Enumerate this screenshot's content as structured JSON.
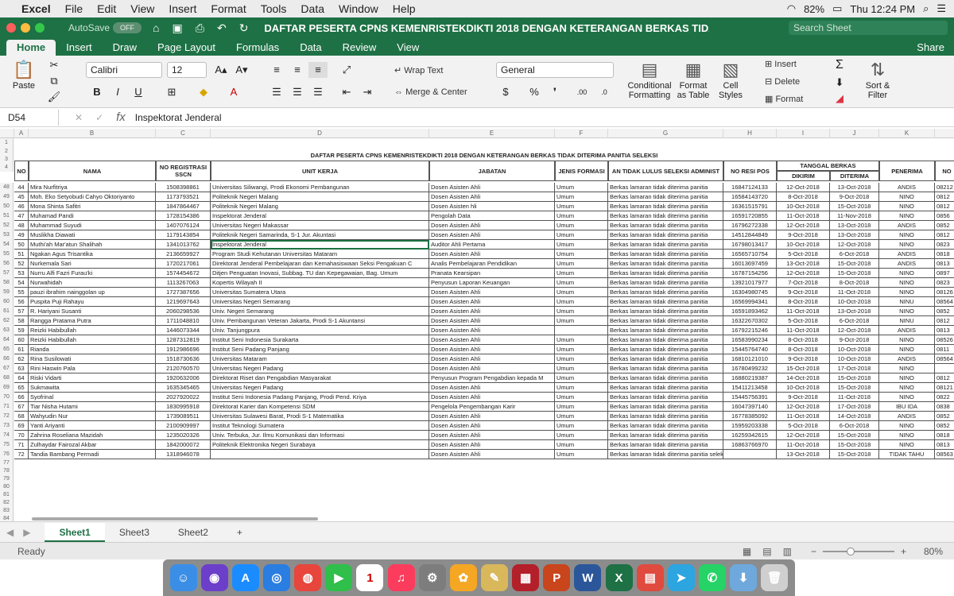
{
  "menubar": {
    "apple": "",
    "app": "Excel",
    "items": [
      "File",
      "Edit",
      "View",
      "Insert",
      "Format",
      "Tools",
      "Data",
      "Window",
      "Help"
    ],
    "battery": "82%",
    "clock": "Thu 12:24 PM"
  },
  "titlebar": {
    "autosave": "AutoSave",
    "toggle": "OFF",
    "doc_title": "DAFTAR PESERTA CPNS KEMENRISTEKDIKTI 2018 DENGAN KETERANGAN BERKAS TIDAK DIT...",
    "search_placeholder": "Search Sheet"
  },
  "ribbon_tabs": [
    "Home",
    "Insert",
    "Draw",
    "Page Layout",
    "Formulas",
    "Data",
    "Review",
    "View"
  ],
  "share": "Share",
  "ribbon": {
    "paste": "Paste",
    "font": "Calibri",
    "size": "12",
    "wrap": "Wrap Text",
    "merge": "Merge & Center",
    "numfmt": "General",
    "cond": [
      "Conditional",
      "Formatting"
    ],
    "fmt_table": [
      "Format",
      "as Table"
    ],
    "cell_styles": [
      "Cell",
      "Styles"
    ],
    "insert": "Insert",
    "delete": "Delete",
    "format": "Format",
    "sort": [
      "Sort &",
      "Filter"
    ]
  },
  "formula_bar": {
    "cell_ref": "D54",
    "formula": "Inspektorat Jenderal"
  },
  "columns": [
    "A",
    "B",
    "C",
    "D",
    "E",
    "F",
    "G",
    "H",
    "I",
    "J",
    "K",
    ""
  ],
  "sheet_title": "DAFTAR PESERTA CPNS KEMENRISTEKDIKTI 2018 DENGAN KETERANGAN BERKAS TIDAK DITERIMA PANITIA SELEKSI",
  "headers": {
    "no": "NO",
    "nama": "NAMA",
    "reg": "NO REGISTRASI SSCN",
    "unit": "UNIT KERJA",
    "jabatan": "JABATAN",
    "jenis": "JENIS FORMASI",
    "alasan": "AN TIDAK LULUS SELEKSI ADMINIST",
    "resi": "NO RESI POS",
    "tanggal": "TANGGAL BERKAS",
    "dikirim": "DIKIRIM",
    "diterima": "DITERIMA",
    "penerima": "PENERIMA",
    "extra": "NO"
  },
  "top_rows": [
    "1",
    "2",
    "3",
    "4"
  ],
  "rows": [
    {
      "r": "48",
      "no": "44",
      "nama": "Mira Nurfitriya",
      "reg": "1508398861",
      "unit": "Universitas Siliwangi, Prodi Ekonomi Pembangunan",
      "jab": "Dosen Asisten Ahli",
      "jenis": "Umum",
      "ket": "Berkas lamaran tidak diterima panitia",
      "resi": "16847124133",
      "kirim": "12-Oct-2018",
      "terima": "13-Oct-2018",
      "pen": "ANDIS",
      "x": "08212"
    },
    {
      "r": "49",
      "no": "45",
      "nama": "Moh. Eko Setyobudi Cahyo Oktoriyanto",
      "reg": "1173793521",
      "unit": "Politeknik Negeri Malang",
      "jab": "Dosen Asisten Ahli",
      "jenis": "Umum",
      "ket": "Berkas lamaran tidak diterima panitia",
      "resi": "16584143720",
      "kirim": "8-Oct-2018",
      "terima": "9-Oct-2018",
      "pen": "NINO",
      "x": "0812"
    },
    {
      "r": "50",
      "no": "46",
      "nama": "Mona Shinta Safitri",
      "reg": "1847864467",
      "unit": "Politeknik Negeri Malang",
      "jab": "Dosen Asisten hli",
      "jenis": "Umum",
      "ket": "Berkas lamaran tidak diterima panitia",
      "resi": "16361515791",
      "kirim": "10-Oct-2018",
      "terima": "15-Oct-2018",
      "pen": "NINO",
      "x": "0812"
    },
    {
      "r": "51",
      "no": "47",
      "nama": "Muhamad Pandi",
      "reg": "1728154386",
      "unit": "Inspektorat Jenderal",
      "jab": "Pengolah Data",
      "jenis": "Umum",
      "ket": "Berkas lamaran tidak diterima panitia",
      "resi": "16591720855",
      "kirim": "11-Oct-2018",
      "terima": "11-Nov-2018",
      "pen": "NINO",
      "x": "0856"
    },
    {
      "r": "52",
      "no": "48",
      "nama": "Muhammad Suyudi",
      "reg": "1407076124",
      "unit": "Universitas Negeri Makassar",
      "jab": "Dosen Asisten Ahli",
      "jenis": "Umum",
      "ket": "Berkas lamaran tidak diterima panitia",
      "resi": "16796272338",
      "kirim": "12-Oct-2018",
      "terima": "13-Oct-2018",
      "pen": "ANDIS",
      "x": "0852"
    },
    {
      "r": "53",
      "no": "49",
      "nama": "Muslikha Diawati",
      "reg": "1179143854",
      "unit": "Politeknik Negeri Samarinda, S-1 Jur. Akuntasi",
      "jab": "Dosen Asisten Ahli",
      "jenis": "Umum",
      "ket": "Berkas lamaran tidak diterima panitia",
      "resi": "14512844849",
      "kirim": "9-Oct-2018",
      "terima": "13-Oct-2018",
      "pen": "NINO",
      "x": "0812"
    },
    {
      "r": "54",
      "no": "50",
      "nama": "Muthi'ah Mar'atun Shalihah",
      "reg": "1341013762",
      "unit": "Inspektorat Jenderal",
      "jab": "Auditor Ahli Pertama",
      "jenis": "Umum",
      "ket": "Berkas lamaran tidak diterima panitia",
      "resi": "16798013417",
      "kirim": "10-Oct-2018",
      "terima": "12-Oct-2018",
      "pen": "NINO",
      "x": "0823"
    },
    {
      "r": "55",
      "no": "51",
      "nama": "Ngakan Agus Trisantika",
      "reg": "2136659927",
      "unit": "Program Studi Kehutanan Universitas Mataram",
      "jab": "Dosen Asisten Ahli",
      "jenis": "Umum",
      "ket": "Berkas lamaran tidak diterima panitia",
      "resi": "16565710754",
      "kirim": "5-Oct-2018",
      "terima": "6-Oct-2018",
      "pen": "ANDIS",
      "x": "0818"
    },
    {
      "r": "56",
      "no": "52",
      "nama": "Nurkemala Sari",
      "reg": "1720217061",
      "unit": "Direktorat Jenderal Pembelajaran dan Kemahasiswaan Seksi Pengakuan C",
      "jab": "Analis Pembelajaran Pendidikan",
      "jenis": "Umum",
      "ket": "Berkas lamaran tidak diterima panitia",
      "resi": "16013697459",
      "kirim": "13-Oct-2018",
      "terima": "15-Oct-2018",
      "pen": "ANDIS",
      "x": "0813"
    },
    {
      "r": "57",
      "no": "53",
      "nama": "Nurru Alfi Fazri Furau'ki",
      "reg": "1574454672",
      "unit": "Ditjen Penguatan Inovasi, Subbag. TU dan Kepegawaian, Bag. Umum",
      "jab": "Pranata Kearsipan",
      "jenis": "Umum",
      "ket": "Berkas lamaran tidak diterima panitia",
      "resi": "16787154256",
      "kirim": "12-Oct-2018",
      "terima": "15-Oct-2018",
      "pen": "NINO",
      "x": "0897"
    },
    {
      "r": "58",
      "no": "54",
      "nama": "Nurwahidah",
      "reg": "1113267063",
      "unit": "Kopertis Wilayah II",
      "jab": "Penyusun Laporan Keuangan",
      "jenis": "Umum",
      "ket": "Berkas lamaran tidak diterima panitia",
      "resi": "13921017977",
      "kirim": "7-Oct-2018",
      "terima": "8-Oct-2018",
      "pen": "NINO",
      "x": "0823"
    },
    {
      "r": "59",
      "no": "55",
      "nama": "pauzi ibrahim nainggolan up",
      "reg": "1727387656",
      "unit": "Universitas Sumatera Utara",
      "jab": "Dosen Asisten Ahli",
      "jenis": "Umum",
      "ket": "Berkas lamaran tidak diterima panitia",
      "resi": "16304980745",
      "kirim": "9-Oct-2018",
      "terima": "11-Oct-2018",
      "pen": "NINO",
      "x": "08126"
    },
    {
      "r": "60",
      "no": "56",
      "nama": "Puspita Puji Rahayu",
      "reg": "1219697643",
      "unit": "Universitas Negeri Semarang",
      "jab": "Dosen Asisten Ahli",
      "jenis": "Umum",
      "ket": "Berkas lamaran tidak diterima panitia",
      "resi": "16569994341",
      "kirim": "8-Oct-2018",
      "terima": "10-Oct-2018",
      "pen": "NINU",
      "x": "08564"
    },
    {
      "r": "61",
      "no": "57",
      "nama": "R. Hariyani Susanti",
      "reg": "2060298536",
      "unit": "Univ. Negeri Semarang",
      "jab": "Dosen Asisten Ahli",
      "jenis": "Umum",
      "ket": "Berkas lamaran tidak diterima panitia",
      "resi": "16591893462",
      "kirim": "11-Oct-2018",
      "terima": "13-Oct-2018",
      "pen": "NINO",
      "x": "0852"
    },
    {
      "r": "62",
      "no": "58",
      "nama": "Rangga Pratama Putra",
      "reg": "1711048810",
      "unit": "Univ. Pembangunan Veteran Jakarta, Prodi S-1 Akuntansi",
      "jab": "Dosen Asisten Ahli",
      "jenis": "Umum",
      "ket": "Berkas lamaran tidak diterima panitia",
      "resi": "16322670302",
      "kirim": "5-Oct-2018",
      "terima": "6-Oct-2018",
      "pen": "NINU",
      "x": "0812"
    },
    {
      "r": "63",
      "no": "59",
      "nama": "Reizki Habibullah",
      "reg": "1446073344",
      "unit": "Univ. Tanjungpura",
      "jab": "Dosen Asisten Ahli",
      "jenis": "",
      "ket": "Berkas lamaran tidak diterima panitia",
      "resi": "16792215246",
      "kirim": "11-Oct-2018",
      "terima": "12-Oct-2018",
      "pen": "ANDIS",
      "x": "0813"
    },
    {
      "r": "64",
      "no": "60",
      "nama": "Reizki Habibullah",
      "reg": "1287312819",
      "unit": "Institut Seni Indonesia Surakarta",
      "jab": "Dosen Asisten Ahli",
      "jenis": "Umum",
      "ket": "Berkas lamaran tidak diterima panitia",
      "resi": "16583990234",
      "kirim": "8-Oct-2018",
      "terima": "9-Oct-2018",
      "pen": "NINO",
      "x": "08526"
    },
    {
      "r": "65",
      "no": "61",
      "nama": "Rianda",
      "reg": "1912986696",
      "unit": "Institut Seni Padang Panjang",
      "jab": "Dosen Asisten Ahli",
      "jenis": "Umum",
      "ket": "Berkas lamaran tidak diterima panitia",
      "resi": "15445764740",
      "kirim": "8-Oct-2018",
      "terima": "10-Oct-2018",
      "pen": "NINO",
      "x": "0811"
    },
    {
      "r": "66",
      "no": "62",
      "nama": "Rina Susilowati",
      "reg": "1518730636",
      "unit": "Universitas Mataram",
      "jab": "Dosen Asisten Ahli",
      "jenis": "Umum",
      "ket": "Berkas lamaran tidak diterima panitia",
      "resi": "16810121010",
      "kirim": "9-Oct-2018",
      "terima": "10-Oct-2018",
      "pen": "ANDIS",
      "x": "08564"
    },
    {
      "r": "67",
      "no": "63",
      "nama": "Rini Haswin Pala",
      "reg": "2120760570",
      "unit": "Universitas Negeri Padang",
      "jab": "Dosen Asisten Ahli",
      "jenis": "Umum",
      "ket": "Berkas lamaran tidak diterima panitia",
      "resi": "16780499232",
      "kirim": "15-Oct-2018",
      "terima": "17-Oct-2018",
      "pen": "NINO",
      "x": ""
    },
    {
      "r": "68",
      "no": "64",
      "nama": "Riski Vidarti",
      "reg": "1920632006",
      "unit": "Direktorat Riset dan Pengabdian Masyarakat",
      "jab": "Penyusun Program Pengabdian kepada M",
      "jenis": "Umum",
      "ket": "Berkas lamaran tidak diterima panitia",
      "resi": "16880219387",
      "kirim": "14-Oct-2018",
      "terima": "15-Oct-2018",
      "pen": "NINO",
      "x": "0812"
    },
    {
      "r": "69",
      "no": "65",
      "nama": "Sukmawita",
      "reg": "1635345465",
      "unit": "Universitas Negeri Padang",
      "jab": "Dosen Asisten Ahli",
      "jenis": "Umum",
      "ket": "Berkas lamaran tidak diterima panitia",
      "resi": "15411213458",
      "kirim": "10-Oct-2018",
      "terima": "15-Oct-2018",
      "pen": "NINO",
      "x": "08121"
    },
    {
      "r": "70",
      "no": "66",
      "nama": "Syofrinal",
      "reg": "2027920022",
      "unit": "Institut Seni Indonesia Padang Panjang, Prodi Pend. Kriya",
      "jab": "Dosen Asisten Ahli",
      "jenis": "Umum",
      "ket": "Berkas lamaran tidak diterima panitia",
      "resi": "15445756391",
      "kirim": "9-Oct-2018",
      "terima": "11-Oct-2018",
      "pen": "NINO",
      "x": "0822"
    },
    {
      "r": "71",
      "no": "67",
      "nama": "Tiar Nisha Hutami",
      "reg": "1830995918",
      "unit": "Direktorat Karier dan Kompetensi SDM",
      "jab": "Pengelola Pengembangan Karir",
      "jenis": "Umum",
      "ket": "Berkas lamaran tidak diterima panitia",
      "resi": "16047397140",
      "kirim": "12-Oct-2018",
      "terima": "17-Oct-2018",
      "pen": "IBU IDA",
      "x": "0838"
    },
    {
      "r": "72",
      "no": "68",
      "nama": "Wahyudin Nur",
      "reg": "1739089511",
      "unit": "Universitas Sulawesi Barat, Prodi S-1 Matematika",
      "jab": "Dosen Asisten Ahli",
      "jenis": "Umum",
      "ket": "Berkas lamaran tidak diterima panitia",
      "resi": "16778385092",
      "kirim": "11-Oct-2018",
      "terima": "14-Oct-2018",
      "pen": "ANDIS",
      "x": "0852"
    },
    {
      "r": "73",
      "no": "69",
      "nama": "Yanti Ariyanti",
      "reg": "2100909997",
      "unit": "Institut Teknologi Sumatera",
      "jab": "Dosen Asisten Ahli",
      "jenis": "Umum",
      "ket": "Berkas lamaran tidak diterima panitia",
      "resi": "15959203338",
      "kirim": "5-Oct-2018",
      "terima": "6-Oct-2018",
      "pen": "NINO",
      "x": "0852"
    },
    {
      "r": "74",
      "no": "70",
      "nama": "Zahrina Roseliana Mazidah",
      "reg": "1235020326",
      "unit": "Univ. Terbuka, Jur. Ilmu Komunikasi dan Informasi",
      "jab": "Dosen Asisten Ahli",
      "jenis": "Umum",
      "ket": "Berkas lamaran tidak diterima panitia",
      "resi": "16259342615",
      "kirim": "12-Oct-2018",
      "terima": "15-Oct-2018",
      "pen": "NINO",
      "x": "0818"
    },
    {
      "r": "75",
      "no": "71",
      "nama": "Zulhaydar Fairozal Akbar",
      "reg": "1842000072",
      "unit": "Politeknik Elektronika Negeri Surabaya",
      "jab": "Dosen Asisten Ahli",
      "jenis": "Umum",
      "ket": "Berkas lamaran tidak diterima panitia",
      "resi": "16863766970",
      "kirim": "11-Oct-2018",
      "terima": "15-Oct-2018",
      "pen": "NINO",
      "x": "0813"
    },
    {
      "r": "76",
      "no": "72",
      "nama": "Tandia Bambang Permadi",
      "reg": "1318946078",
      "unit": "",
      "jab": "Dosen Asisten Ahli",
      "jenis": "Umum",
      "ket": "Berkas lamaran tidak diterima panitia seleksi sampai bata",
      "resi": "",
      "kirim": "13-Oct-2018",
      "terima": "15-Oct-2018",
      "pen": "TIDAK TAHU",
      "x": "08563"
    }
  ],
  "empty_rows": [
    "77",
    "78",
    "79",
    "80",
    "81",
    "82",
    "83",
    "84"
  ],
  "sheet_tabs": [
    "Sheet1",
    "Sheet3",
    "Sheet2"
  ],
  "add_sheet": "+",
  "status": {
    "ready": "Ready",
    "zoom": "80%"
  },
  "dock": [
    "Finder",
    "Siri",
    "App Store",
    "Safari",
    "Chrome",
    "FaceTime",
    "Calendar",
    "iTunes",
    "System Preferences",
    "Photos",
    "Notes",
    "Mendeley",
    "PowerPoint",
    "Word",
    "Excel",
    "PDF",
    "Telegram",
    "WhatsApp",
    "Downloads",
    "Trash"
  ]
}
